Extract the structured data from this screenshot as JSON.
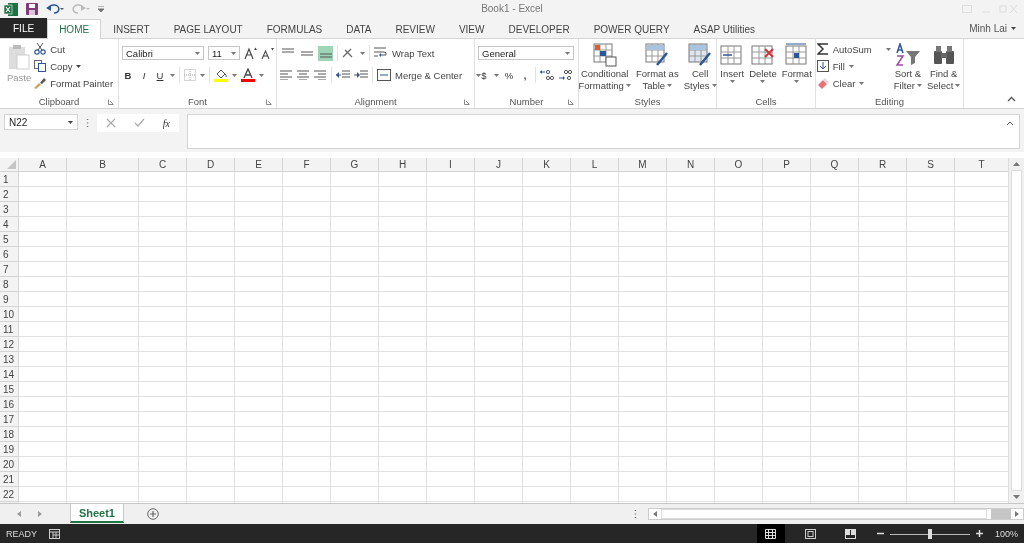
{
  "window": {
    "title": "Book1 - Excel",
    "user": "Minh Lai"
  },
  "tabs": [
    {
      "label": "FILE",
      "kind": "file",
      "selected": false
    },
    {
      "label": "HOME",
      "kind": "tab",
      "selected": true
    },
    {
      "label": "INSERT",
      "kind": "tab",
      "selected": false
    },
    {
      "label": "PAGE LAYOUT",
      "kind": "tab",
      "selected": false
    },
    {
      "label": "FORMULAS",
      "kind": "tab",
      "selected": false
    },
    {
      "label": "DATA",
      "kind": "tab",
      "selected": false
    },
    {
      "label": "REVIEW",
      "kind": "tab",
      "selected": false
    },
    {
      "label": "VIEW",
      "kind": "tab",
      "selected": false
    },
    {
      "label": "DEVELOPER",
      "kind": "tab",
      "selected": false
    },
    {
      "label": "POWER QUERY",
      "kind": "tab",
      "selected": false
    },
    {
      "label": "ASAP Utilities",
      "kind": "tab",
      "selected": false
    }
  ],
  "ribbon": {
    "clipboard": {
      "label": "Clipboard",
      "paste": {
        "label": "Paste",
        "disabled": true
      },
      "cut": "Cut",
      "copy": "Copy",
      "format_painter": "Format Painter"
    },
    "font": {
      "label": "Font",
      "name": "Calibri",
      "size": "11",
      "bold": "B",
      "italic": "I",
      "underline": "U"
    },
    "alignment": {
      "label": "Alignment",
      "vertical": [
        {
          "selected": false
        },
        {
          "selected": false
        },
        {
          "selected": true
        }
      ],
      "wrap_text": "Wrap Text",
      "merge_center": "Merge & Center"
    },
    "number": {
      "label": "Number",
      "format": "General",
      "currency": "$",
      "percent": "%",
      "comma": ","
    },
    "styles": {
      "label": "Styles",
      "buttons": [
        {
          "lines": [
            "Conditional",
            "Formatting"
          ]
        },
        {
          "lines": [
            "Format as",
            "Table"
          ]
        },
        {
          "lines": [
            "Cell",
            "Styles"
          ]
        }
      ]
    },
    "cells": {
      "label": "Cells",
      "buttons": [
        "Insert",
        "Delete",
        "Format"
      ]
    },
    "editing": {
      "label": "Editing",
      "autosum": "AutoSum",
      "fill": "Fill",
      "clear": "Clear",
      "buttons": [
        {
          "lines": [
            "Sort &",
            "Filter"
          ]
        },
        {
          "lines": [
            "Find &",
            "Select"
          ]
        }
      ]
    }
  },
  "formula_bar": {
    "name_box": "N22",
    "function": "fx"
  },
  "sheet": {
    "columns": [
      "A",
      "B",
      "C",
      "D",
      "E",
      "F",
      "G",
      "H",
      "I",
      "J",
      "K",
      "L",
      "M",
      "N",
      "O",
      "P",
      "Q",
      "R",
      "S",
      "T"
    ],
    "rows": [
      "1",
      "2",
      "3",
      "4",
      "5",
      "6",
      "7",
      "8",
      "9",
      "10",
      "11",
      "12",
      "13",
      "14",
      "15",
      "16",
      "17",
      "18",
      "19",
      "20",
      "21",
      "22"
    ]
  },
  "sheet_tabs": [
    {
      "label": "Sheet1",
      "selected": true
    }
  ],
  "status_bar": {
    "mode": "READY",
    "views": [
      {
        "selected": true
      },
      {
        "selected": false
      },
      {
        "selected": false
      }
    ],
    "zoom": {
      "level": 0.5,
      "reading": "100%"
    }
  }
}
